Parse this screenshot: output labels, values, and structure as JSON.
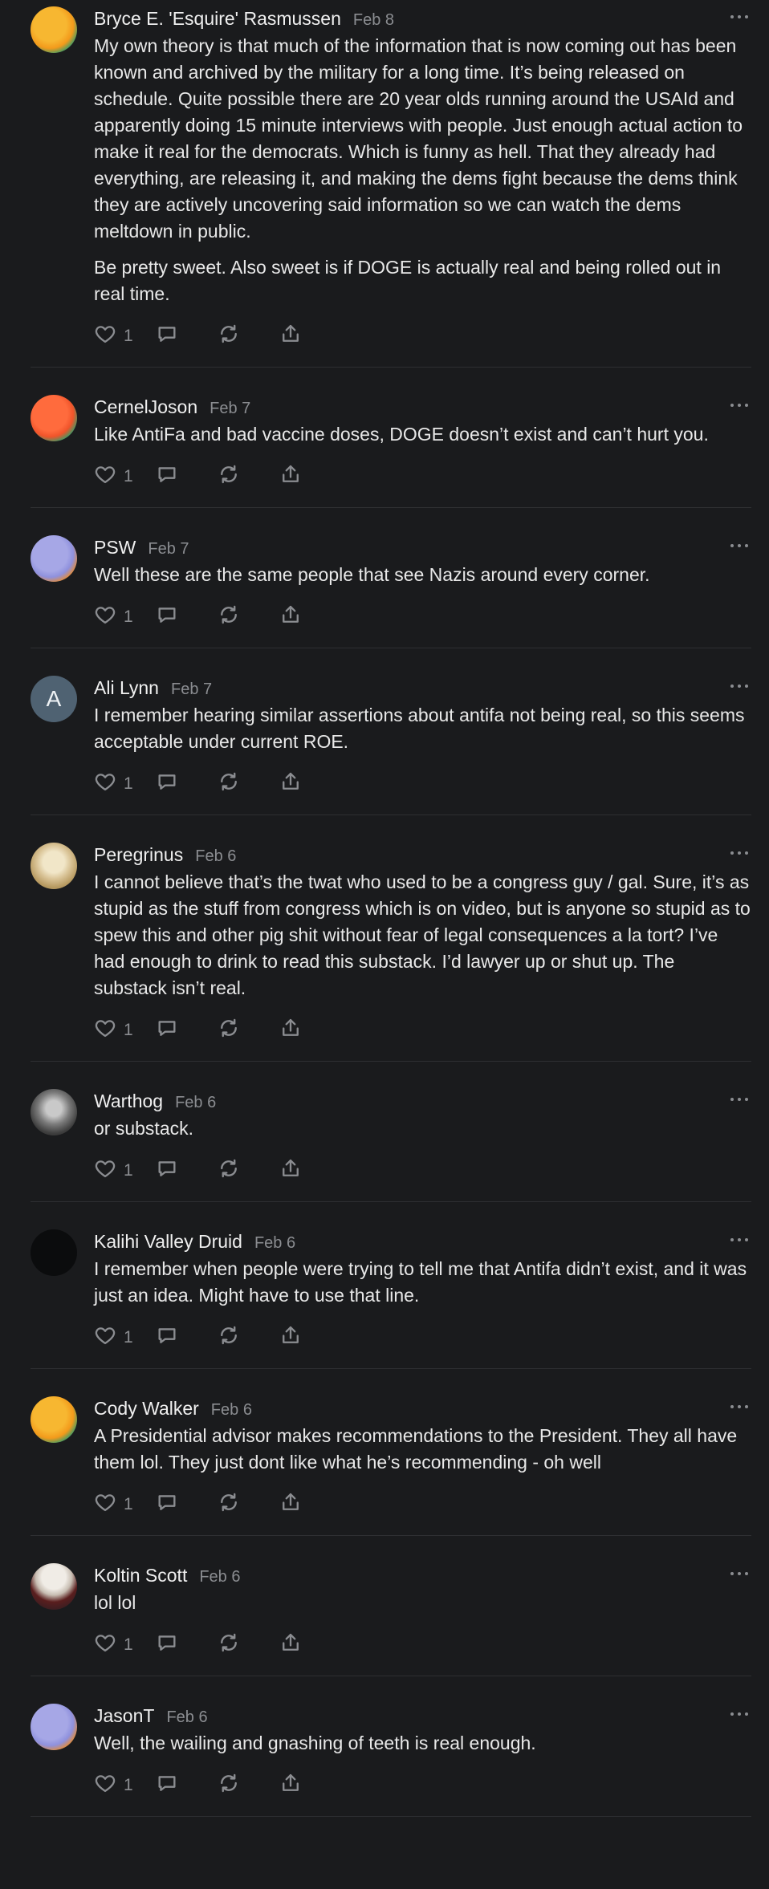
{
  "comments": [
    {
      "author": "Bryce E. 'Esquire' Rasmussen",
      "date": "Feb 8",
      "avatar": "orange",
      "paragraphs": [
        "My own theory is that much of the information that is now coming out has been known and archived by the military for a long time. It’s being released on schedule. Quite possible there are 20 year olds running around the USAId and apparently doing 15 minute interviews with people. Just enough actual action to make it real for the democrats. Which is funny as hell. That they already had everything, are releasing it, and making the dems fight because the dems think they are actively uncovering said information so we can watch the dems meltdown in public.",
        "Be pretty sweet. Also sweet is if DOGE is actually real and being rolled out in real time."
      ],
      "likes": "1"
    },
    {
      "author": "CernelJoson",
      "date": "Feb 7",
      "avatar": "red",
      "paragraphs": [
        "Like AntiFa and bad vaccine doses, DOGE doesn’t exist and can’t hurt you."
      ],
      "likes": "1"
    },
    {
      "author": "PSW",
      "date": "Feb 7",
      "avatar": "lilac",
      "paragraphs": [
        "Well these are the same people that see Nazis around every corner."
      ],
      "likes": "1"
    },
    {
      "author": "Ali Lynn",
      "date": "Feb 7",
      "avatar": "letter",
      "avatar_letter": "A",
      "paragraphs": [
        "I remember hearing similar assertions about antifa not being real, so this seems acceptable under current ROE."
      ],
      "likes": "1"
    },
    {
      "author": "Peregrinus",
      "date": "Feb 6",
      "avatar": "photo-peregrinus",
      "paragraphs": [
        "I cannot believe that’s the twat who used to be a congress guy / gal. Sure, it’s as stupid as the stuff from congress which is on video, but is anyone so stupid as to spew this and other pig shit without fear of legal consequences a la tort? I’ve had enough to drink to read this substack. I’d lawyer up or shut up. The substack isn’t real."
      ],
      "likes": "1"
    },
    {
      "author": "Warthog",
      "date": "Feb 6",
      "avatar": "photo-warthog",
      "paragraphs": [
        "or substack."
      ],
      "likes": "1"
    },
    {
      "author": "Kalihi Valley Druid",
      "date": "Feb 6",
      "avatar": "photo-druid",
      "paragraphs": [
        "I remember when people were trying to tell me that Antifa didn’t exist, and it was just an idea. Might have to use that line."
      ],
      "likes": "1"
    },
    {
      "author": "Cody Walker",
      "date": "Feb 6",
      "avatar": "orange",
      "paragraphs": [
        "A Presidential advisor makes recommendations to the President. They all have them lol. They just dont like what he’s recommending - oh well"
      ],
      "likes": "1"
    },
    {
      "author": "Koltin Scott",
      "date": "Feb 6",
      "avatar": "photo-koltin",
      "paragraphs": [
        "lol lol"
      ],
      "likes": "1"
    },
    {
      "author": "JasonT",
      "date": "Feb 6",
      "avatar": "lilac",
      "paragraphs": [
        "Well, the wailing and gnashing of teeth is real enough."
      ],
      "likes": "1"
    }
  ],
  "icons": {
    "like": "heart-icon",
    "reply": "comment-icon",
    "restack": "restack-icon",
    "share": "share-icon",
    "more": "more-icon"
  }
}
